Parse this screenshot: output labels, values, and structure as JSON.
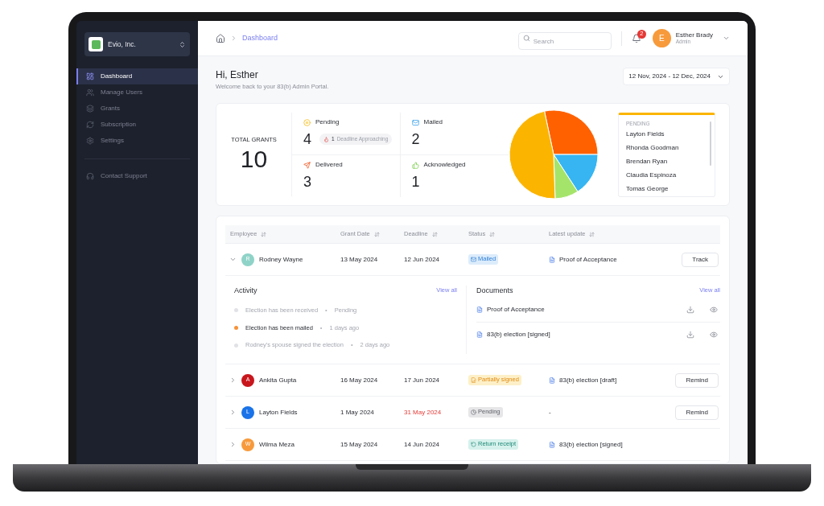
{
  "sidebar": {
    "company": "Evio, Inc.",
    "items": [
      {
        "label": "Dashboard",
        "selected": true
      },
      {
        "label": "Manage Users",
        "selected": false
      },
      {
        "label": "Grants",
        "selected": false
      },
      {
        "label": "Subscription",
        "selected": false
      },
      {
        "label": "Settings",
        "selected": false
      }
    ],
    "support": "Contact Support"
  },
  "header": {
    "breadcrumb": "Dashboard",
    "search": {
      "placeholder": "Search"
    },
    "notifications": "2",
    "user": {
      "initial": "E",
      "name": "Esther Brady",
      "role": "Admin"
    }
  },
  "greeting": {
    "title": "Hi, Esther",
    "subtitle": "Welcome back to your 83(b) Admin Portal.",
    "date_range": "12 Nov, 2024 - 12 Dec, 2024"
  },
  "summary": {
    "total_label": "TOTAL GRANTS",
    "total": "10",
    "stats": [
      {
        "kind": "pending",
        "label": "Pending",
        "value": "4",
        "badge_count": "1",
        "badge_text": "Deadline Approaching"
      },
      {
        "kind": "mailed",
        "label": "Mailed",
        "value": "2"
      },
      {
        "kind": "delivered",
        "label": "Delivered",
        "value": "3"
      },
      {
        "kind": "acknowledged",
        "label": "Acknowledged",
        "value": "1"
      }
    ],
    "pending_list": {
      "title": "PENDING",
      "names": [
        "Layton Fields",
        "Rhonda Goodman",
        "Brendan Ryan",
        "Claudia Espinoza",
        "Tomas George"
      ]
    }
  },
  "table": {
    "columns": [
      "Employee",
      "Grant Date",
      "Deadline",
      "Status",
      "Latest update"
    ],
    "rows": [
      {
        "initial": "R",
        "color": "#8fd3c8",
        "name": "Rodney Wayne",
        "grant_date": "13 May 2024",
        "deadline": "12 Jun 2024",
        "overdue": false,
        "status": {
          "kind": "mailed",
          "label": "Mailed"
        },
        "latest_update": "Proof of Acceptance",
        "action": "Track",
        "expanded": true,
        "activity": {
          "title": "Activity",
          "link": "View all",
          "items": [
            {
              "text": "Election has been received",
              "separator": "•",
              "meta": "Pending",
              "selected": false
            },
            {
              "text": "Election has been mailed",
              "separator": "•",
              "meta": "1 days ago",
              "selected": true
            },
            {
              "text": "Rodney's spouse signed the election",
              "separator": "•",
              "meta": "2 days ago",
              "selected": false
            }
          ]
        },
        "documents": {
          "title": "Documents",
          "link": "View all",
          "items": [
            "Proof of Acceptance",
            "83(b) election [signed]"
          ]
        }
      },
      {
        "initial": "A",
        "color": "#c8161d",
        "name": "Ankita Gupta",
        "grant_date": "16 May 2024",
        "deadline": "17 Jun 2024",
        "overdue": false,
        "status": {
          "kind": "partial",
          "label": "Partially signed"
        },
        "latest_update": "83(b) election [draft]",
        "action": "Remind",
        "expanded": false
      },
      {
        "initial": "L",
        "color": "#1a73e8",
        "name": "Layton Fields",
        "grant_date": "1 May 2024",
        "deadline": "31 May 2024",
        "overdue": true,
        "status": {
          "kind": "pending",
          "label": "Pending"
        },
        "latest_update": "-",
        "action": "Remind",
        "expanded": false
      },
      {
        "initial": "W",
        "color": "#f79a3c",
        "name": "Wilma Meza",
        "grant_date": "15 May 2024",
        "deadline": "14 Jun 2024",
        "overdue": false,
        "status": {
          "kind": "returned",
          "label": "Return receipt"
        },
        "latest_update": "83(b) election [signed]",
        "expanded": false
      }
    ]
  }
}
